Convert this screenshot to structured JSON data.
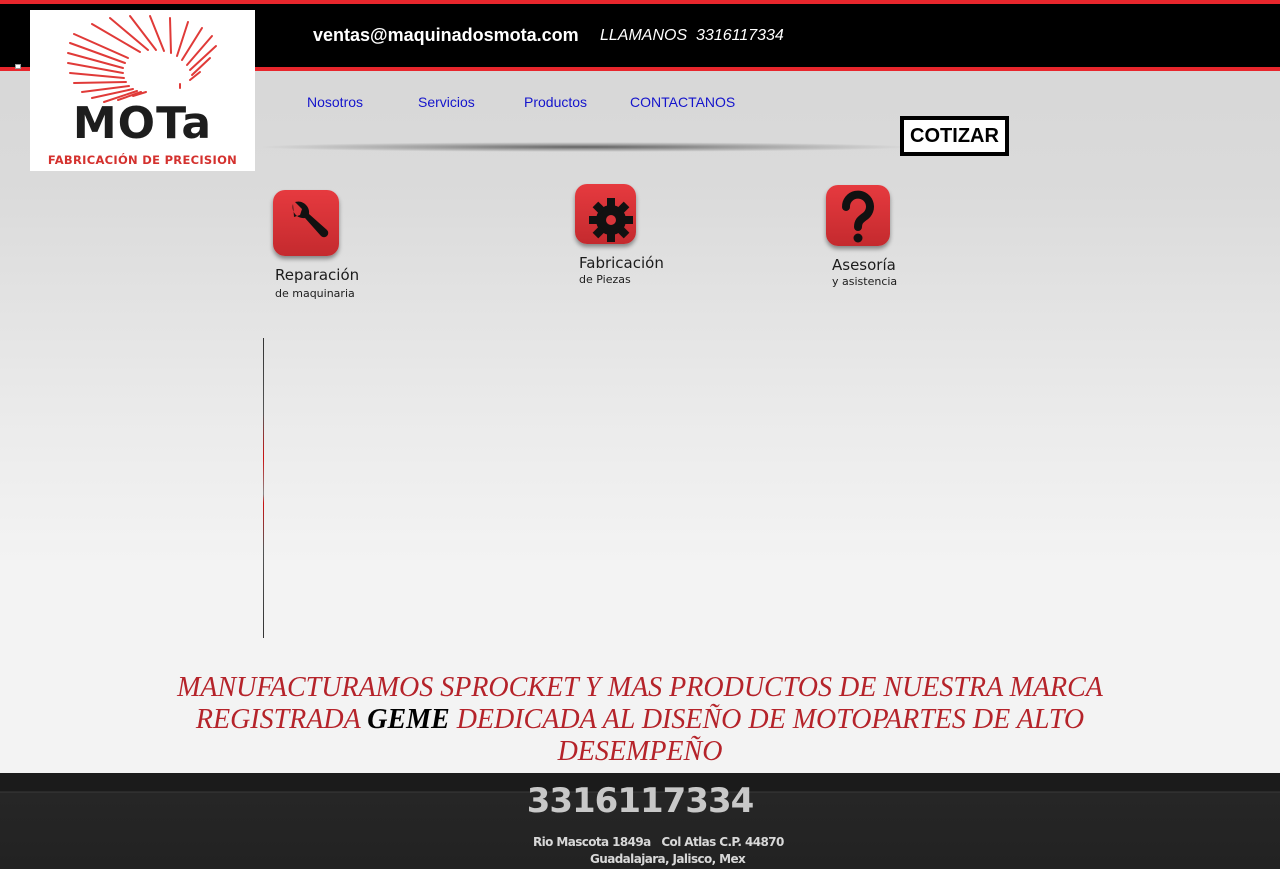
{
  "header": {
    "email": "ventas@maquinadosmota.com",
    "phone_label": "LLAMANOS  3316117334"
  },
  "logo": {
    "brand": "MOTa",
    "tagline": "FABRICACIÓN  DE PRECISION"
  },
  "nav": {
    "items": [
      {
        "label": "Nosotros"
      },
      {
        "label": "Servicios"
      },
      {
        "label": "Productos"
      },
      {
        "label": "CONTACTANOS"
      }
    ],
    "cta_label": "COTIZAR"
  },
  "services": [
    {
      "title": "Reparación",
      "subtitle": "de maquinaria",
      "icon": "wrench-icon"
    },
    {
      "title": "Fabricación",
      "subtitle": "de Piezas",
      "icon": "gear-icon"
    },
    {
      "title": "Asesoría",
      "subtitle": "y asistencia",
      "icon": "question-icon"
    }
  ],
  "headline": {
    "before": "MANUFACTURAMOS SPROCKET Y MAS PRODUCTOS DE NUESTRA MARCA REGISTRADA ",
    "brand": "GEME",
    "after": " DEDICADA AL DISEÑO DE MOTOPARTES DE ALTO DESEMPEÑO"
  },
  "footer": {
    "phone": "3316117334",
    "address_line1": "Rio Mascota 1849a   Col Atlas C.P. 44870",
    "address_line2": "Guadalajara, Jalisco, Mex"
  },
  "colors": {
    "accent_red": "#e8262c",
    "nav_link": "#1414cc",
    "headline_red": "#b5232a"
  }
}
